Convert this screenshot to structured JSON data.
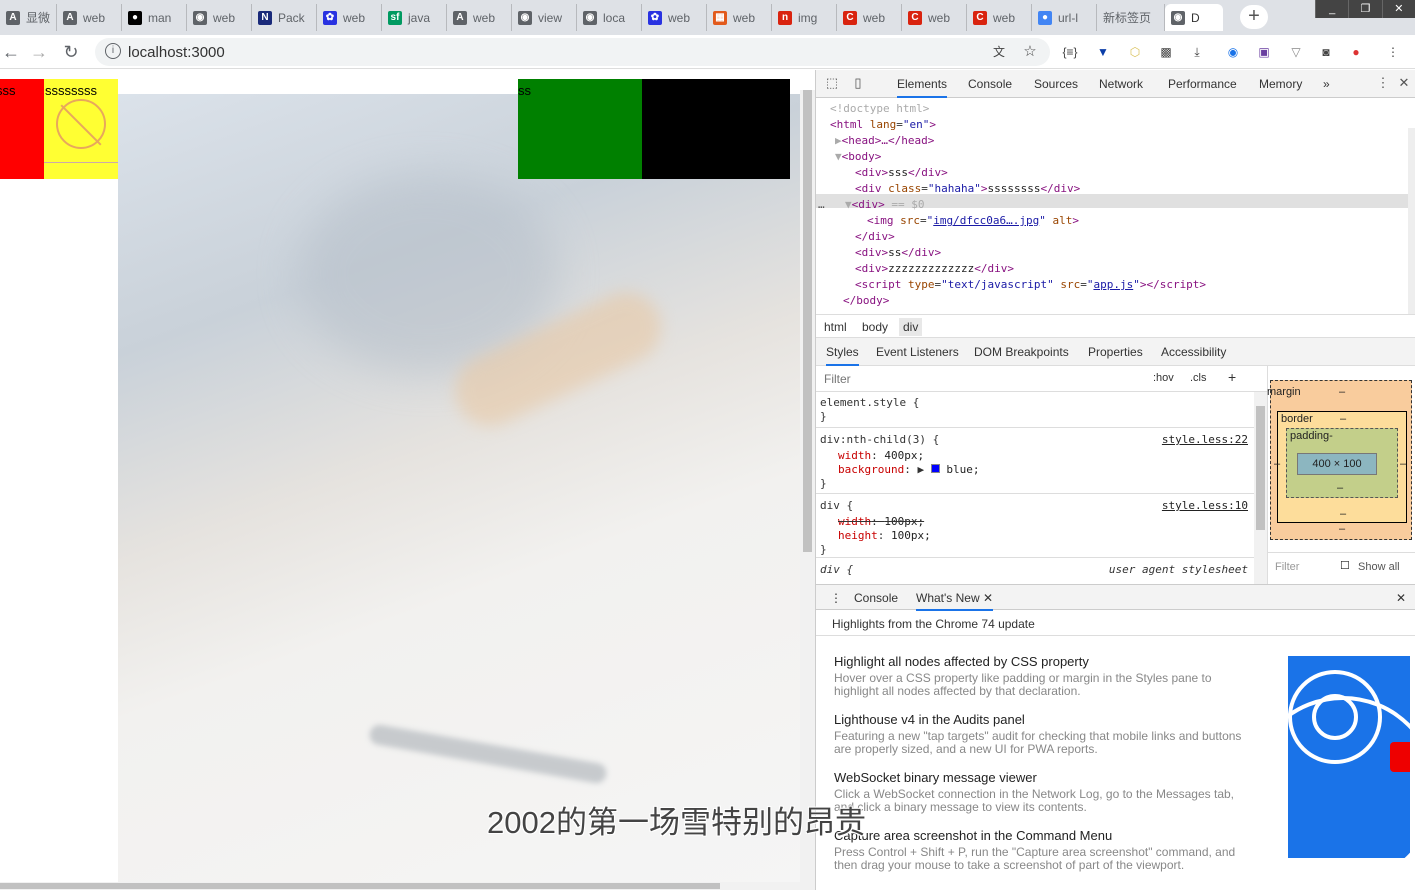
{
  "tabs": [
    {
      "title": "显微",
      "icon": "translate-icon",
      "icon_glyph": "A",
      "color": "#5f6368"
    },
    {
      "title": "web",
      "icon": "translate-icon",
      "icon_glyph": "A",
      "color": "#5f6368"
    },
    {
      "title": "man",
      "icon": "github-icon",
      "icon_glyph": "●",
      "color": "#000000"
    },
    {
      "title": "web",
      "icon": "globe-icon",
      "icon_glyph": "◉",
      "color": "#5f6368"
    },
    {
      "title": "Pack",
      "icon": "n-logo-icon",
      "icon_glyph": "N",
      "color": "#1a2a7a"
    },
    {
      "title": "web",
      "icon": "baidu-paw-icon",
      "icon_glyph": "✿",
      "color": "#2932e1"
    },
    {
      "title": "java",
      "icon": "sf-logo-icon",
      "icon_glyph": "sf",
      "color": "#009a61"
    },
    {
      "title": "web",
      "icon": "translate-icon",
      "icon_glyph": "A",
      "color": "#5f6368"
    },
    {
      "title": "view",
      "icon": "globe-icon",
      "icon_glyph": "◉",
      "color": "#5f6368"
    },
    {
      "title": "loca",
      "icon": "globe-icon",
      "icon_glyph": "◉",
      "color": "#5f6368"
    },
    {
      "title": "web",
      "icon": "baidu-paw-icon",
      "icon_glyph": "✿",
      "color": "#2932e1"
    },
    {
      "title": "web",
      "icon": "grid-logo-icon",
      "icon_glyph": "▦",
      "color": "#e25a1c"
    },
    {
      "title": "img",
      "icon": "n-square-icon",
      "icon_glyph": "n",
      "color": "#d9230f"
    },
    {
      "title": "web",
      "icon": "c-logo-icon",
      "icon_glyph": "C",
      "color": "#d9230f"
    },
    {
      "title": "web",
      "icon": "c-logo-icon",
      "icon_glyph": "C",
      "color": "#d9230f"
    },
    {
      "title": "web",
      "icon": "c-logo-icon",
      "icon_glyph": "C",
      "color": "#d9230f"
    },
    {
      "title": "url-l",
      "icon": "dot-logo-icon",
      "icon_glyph": "●",
      "color": "#4285f4"
    },
    {
      "title": "新标签页",
      "icon": "",
      "icon_glyph": "",
      "color": ""
    },
    {
      "title": "D",
      "icon": "globe-icon",
      "icon_glyph": "◉",
      "color": "#5f6368",
      "active": true
    }
  ],
  "new_tab_label": "+",
  "window_controls": {
    "minimize": "_",
    "restore": "❐",
    "close": "✕"
  },
  "address_bar": {
    "url": "localhost:3000",
    "info_glyph": "i"
  },
  "page": {
    "red_text": "sss",
    "yellow_text": "ssssssss",
    "green_text": "ss"
  },
  "subtitle": "2002的第一场雪特别的昂贵",
  "devtools": {
    "tabs": [
      "Elements",
      "Console",
      "Sources",
      "Network",
      "Performance",
      "Memory"
    ],
    "active_tab": "Elements",
    "more_label": "»",
    "dom": {
      "doctype": "<!doctype html>",
      "html_open": "<html",
      "html_attr": "lang",
      "html_val": "\"en\"",
      "head": "<head>…</head>",
      "body_open": "<body>",
      "div1_text": "sss",
      "div2_class": "\"hahaha\"",
      "div2_text": "ssssssss",
      "div3_marker": "== $0",
      "img_src": "img/dfcc0a6….jpg",
      "div4_text": "ss",
      "div5_text": "zzzzzzzzzzzzz",
      "script_type": "\"text/javascript\"",
      "script_src": "app.js",
      "body_close": "</body>"
    },
    "breadcrumbs": [
      "html",
      "body",
      "div"
    ],
    "subtabs": [
      "Styles",
      "Event Listeners",
      "DOM Breakpoints",
      "Properties",
      "Accessibility"
    ],
    "filter_placeholder": "Filter",
    "hov_label": ":hov",
    "cls_label": ".cls",
    "styles": {
      "element_style": "element.style {",
      "rule1_selector": "div:nth-child(3) {",
      "rule1_source": "style.less:22",
      "rule1_width": "400px;",
      "rule1_bg": "blue;",
      "rule2_selector": "div {",
      "rule2_source": "style.less:10",
      "rule2_width": "100px;",
      "rule2_height": "100px;",
      "rule3_selector": "div {",
      "rule3_source": "user agent stylesheet"
    },
    "box_model": {
      "margin_label": "margin",
      "border_label": "border",
      "padding_label": "padding-",
      "content": "400 × 100",
      "dash": "–",
      "filter": "Filter",
      "show_all": "Show all"
    },
    "drawer": {
      "tabs": [
        "Console",
        "What's New"
      ],
      "active_tab": "What's New",
      "header": "Highlights from the Chrome 74 update",
      "items": [
        {
          "title": "Highlight all nodes affected by CSS property",
          "desc": "Hover over a CSS property like padding or margin in the Styles pane to highlight all nodes affected by that declaration."
        },
        {
          "title": "Lighthouse v4 in the Audits panel",
          "desc": "Featuring a new \"tap targets\" audit for checking that mobile links and buttons are properly sized, and a new UI for PWA reports."
        },
        {
          "title": "WebSocket binary message viewer",
          "desc": "Click a WebSocket connection in the Network Log, go to the Messages tab, and click a binary message to view its contents."
        },
        {
          "title": "Capture area screenshot in the Command Menu",
          "desc": "Press Control + Shift + P, run the \"Capture area screenshot\" command, and then drag your mouse to take a screenshot of part of the viewport."
        }
      ]
    }
  },
  "colors": {
    "red_box": "#ff0000",
    "yellow_box": "#ffff33",
    "green_box": "#008000",
    "black_box": "#000000",
    "accent": "#1a73e8"
  }
}
